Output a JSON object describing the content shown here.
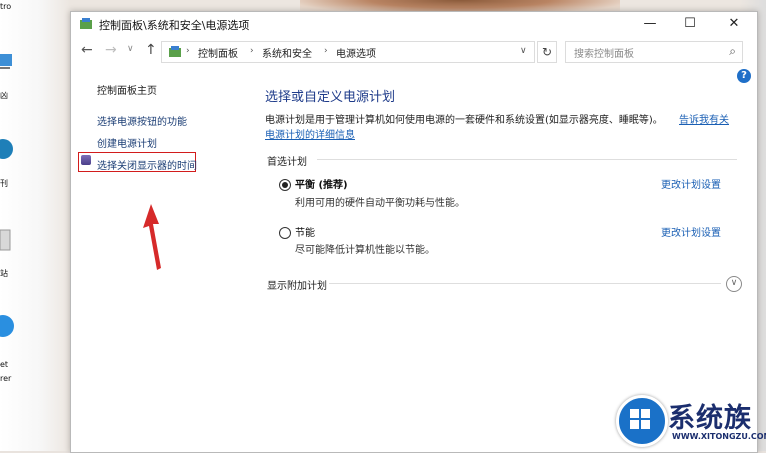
{
  "window": {
    "title": "控制面板\\系统和安全\\电源选项",
    "controls": {
      "minimize": "—",
      "maximize": "☐",
      "close": "✕"
    }
  },
  "address": {
    "crumbs": [
      "控制面板",
      "系统和安全",
      "电源选项"
    ],
    "search_placeholder": "搜索控制面板"
  },
  "sidebar": {
    "home": "控制面板主页",
    "items": [
      "选择电源按钮的功能",
      "创建电源计划",
      "选择关闭显示器的时间"
    ]
  },
  "main": {
    "heading": "选择或自定义电源计划",
    "description": "电源计划是用于管理计算机如何使用电源的一套硬件和系统设置(如显示器亮度、睡眠等)。",
    "description_link_part1": "告诉我有关",
    "description_link_part2": "电源计划的详细信息",
    "preferred_label": "首选计划",
    "plans": [
      {
        "name": "平衡 (推荐)",
        "desc": "利用可用的硬件自动平衡功耗与性能。",
        "change": "更改计划设置",
        "selected": true
      },
      {
        "name": "节能",
        "desc": "尽可能降低计算机性能以节能。",
        "change": "更改计划设置",
        "selected": false
      }
    ],
    "additional_label": "显示附加计划"
  },
  "desktop_icons": [
    "tro",
    "凶",
    "刊",
    "站",
    "et",
    "rer"
  ],
  "watermark": {
    "text": "系统族",
    "url": "WWW.XITONGZU.COM"
  },
  "colors": {
    "link": "#1a5fb4",
    "heading": "#1e3b8a",
    "highlight": "#d21c1c",
    "help": "#1f6fc8"
  }
}
